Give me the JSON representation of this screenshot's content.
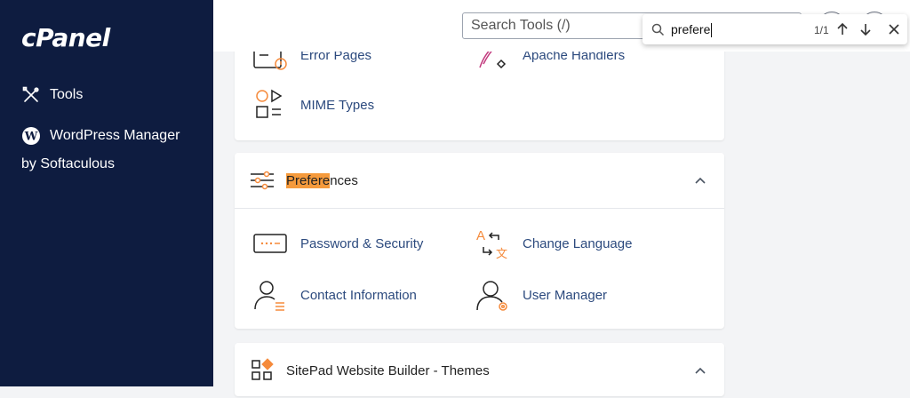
{
  "sidebar": {
    "logo": "cPanel",
    "items": [
      {
        "label": "Tools",
        "icon": "tools-icon"
      },
      {
        "label": "WordPress Manager",
        "icon": "wordpress-icon"
      }
    ],
    "wordpress_sub": "by Softaculous"
  },
  "topbar": {
    "search_placeholder": "Search Tools (/)"
  },
  "findbar": {
    "query": "prefere",
    "count": "1/1"
  },
  "sections": {
    "advanced_partial": {
      "items": [
        {
          "label": "Error Pages",
          "icon": "error-pages-icon"
        },
        {
          "label": "Apache Handlers",
          "icon": "apache-handlers-icon"
        },
        {
          "label": "MIME Types",
          "icon": "mime-types-icon"
        }
      ]
    },
    "preferences": {
      "title_highlight": "Prefere",
      "title_rest": "nces",
      "items": [
        {
          "label": "Password & Security",
          "icon": "password-security-icon"
        },
        {
          "label": "Change Language",
          "icon": "change-language-icon"
        },
        {
          "label": "Contact Information",
          "icon": "contact-information-icon"
        },
        {
          "label": "User Manager",
          "icon": "user-manager-icon"
        }
      ]
    },
    "sitepad": {
      "title": "SitePad Website Builder - Themes"
    }
  },
  "colors": {
    "sidebar_bg": "#0e1c40",
    "link": "#2c4a7e",
    "accent": "#f58a3b",
    "highlight": "#f59a3c"
  }
}
